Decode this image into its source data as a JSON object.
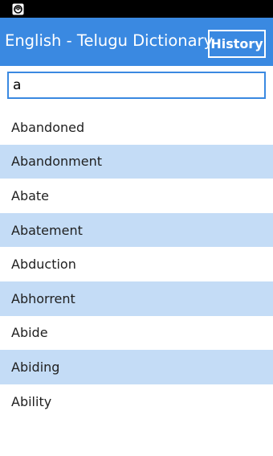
{
  "status_bar": {
    "icon": "app-notification-icon"
  },
  "header": {
    "title": "English - Telugu Dictionary",
    "history_label": "History",
    "accent_color": "#3a89e1"
  },
  "search": {
    "value": "a",
    "placeholder": ""
  },
  "word_list": {
    "alt_row_color": "#c4dcf6",
    "items": [
      {
        "label": "Abandoned"
      },
      {
        "label": "Abandonment"
      },
      {
        "label": "Abate"
      },
      {
        "label": "Abatement"
      },
      {
        "label": "Abduction"
      },
      {
        "label": "Abhorrent"
      },
      {
        "label": "Abide"
      },
      {
        "label": "Abiding"
      },
      {
        "label": "Ability"
      }
    ]
  }
}
